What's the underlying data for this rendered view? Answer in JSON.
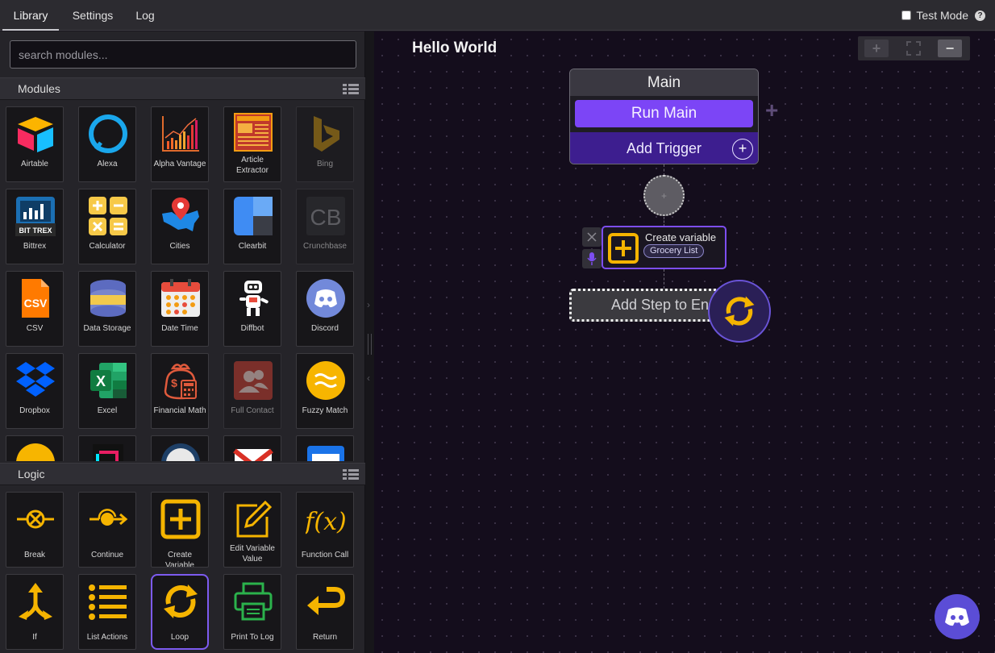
{
  "tabs": [
    {
      "label": "Library",
      "active": true
    },
    {
      "label": "Settings",
      "active": false
    },
    {
      "label": "Log",
      "active": false
    }
  ],
  "test_mode": {
    "label": "Test Mode",
    "checked": false
  },
  "search": {
    "placeholder": "search modules..."
  },
  "modules_section": {
    "title": "Modules"
  },
  "modules": [
    {
      "label": "Airtable",
      "icon": "airtable-icon"
    },
    {
      "label": "Alexa",
      "icon": "alexa-icon"
    },
    {
      "label": "Alpha Vantage",
      "icon": "alpha-vantage-icon"
    },
    {
      "label": "Article Extractor",
      "icon": "article-extractor-icon"
    },
    {
      "label": "Bing",
      "icon": "bing-icon",
      "disabled": true
    },
    {
      "label": "Bittrex",
      "icon": "bittrex-icon"
    },
    {
      "label": "Calculator",
      "icon": "calculator-icon"
    },
    {
      "label": "Cities",
      "icon": "cities-icon"
    },
    {
      "label": "Clearbit",
      "icon": "clearbit-icon"
    },
    {
      "label": "Crunchbase",
      "icon": "crunchbase-icon",
      "disabled": true
    },
    {
      "label": "CSV",
      "icon": "csv-icon"
    },
    {
      "label": "Data Storage",
      "icon": "data-storage-icon"
    },
    {
      "label": "Date Time",
      "icon": "date-time-icon"
    },
    {
      "label": "Diffbot",
      "icon": "diffbot-icon"
    },
    {
      "label": "Discord",
      "icon": "discord-icon"
    },
    {
      "label": "Dropbox",
      "icon": "dropbox-icon"
    },
    {
      "label": "Excel",
      "icon": "excel-icon"
    },
    {
      "label": "Financial Math",
      "icon": "financial-math-icon"
    },
    {
      "label": "Full Contact",
      "icon": "full-contact-icon",
      "disabled": true
    },
    {
      "label": "Fuzzy Match",
      "icon": "fuzzy-match-icon"
    }
  ],
  "logic_section": {
    "title": "Logic"
  },
  "logic": [
    {
      "label": "Break",
      "icon": "break-icon"
    },
    {
      "label": "Continue",
      "icon": "continue-icon"
    },
    {
      "label": "Create Variable",
      "icon": "create-variable-icon"
    },
    {
      "label": "Edit Variable Value",
      "icon": "edit-variable-icon"
    },
    {
      "label": "Function Call",
      "icon": "function-call-icon"
    },
    {
      "label": "If",
      "icon": "if-icon"
    },
    {
      "label": "List Actions",
      "icon": "list-actions-icon"
    },
    {
      "label": "Loop",
      "icon": "loop-icon",
      "selected": true
    },
    {
      "label": "Print To Log",
      "icon": "print-to-log-icon"
    },
    {
      "label": "Return",
      "icon": "return-icon"
    }
  ],
  "canvas": {
    "title": "Hello World",
    "main_card": {
      "header": "Main",
      "run_button": "Run Main",
      "add_trigger": "Add Trigger"
    },
    "step": {
      "name": "Create variable",
      "variable": "Grocery List"
    },
    "add_step": "Add Step to End"
  },
  "colors": {
    "accent": "#7c45f6",
    "trigger_bg": "#3d1e8f",
    "logic_icon": "#f5b400",
    "discord": "#5b4dd6"
  }
}
